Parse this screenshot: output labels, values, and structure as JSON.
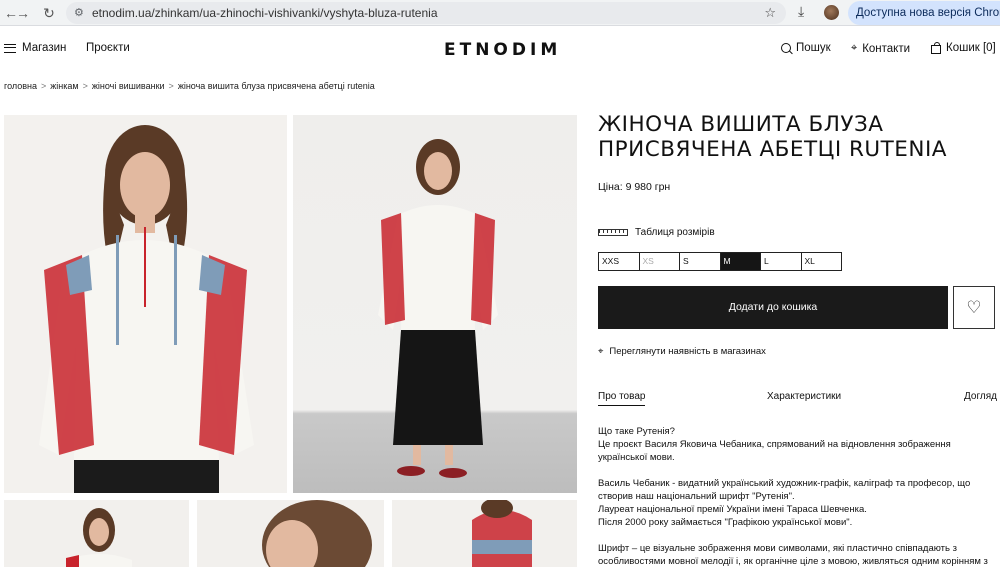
{
  "browser": {
    "url": "etnodim.ua/zhinkam/ua-zhinochi-vishivanki/vyshyta-bluza-rutenia",
    "update_label": "Доступна нова версія Chrome"
  },
  "header": {
    "menu_label": "Магазин",
    "projects_label": "Проєкти",
    "logo": "ETNODIM",
    "search_label": "Пошук",
    "contacts_label": "Контакти",
    "cart_label": "Кошик [0]"
  },
  "breadcrumb": [
    "головна",
    "жінкам",
    "жіночі вишиванки",
    "жіноча вишита блуза присвячена абетці rutenia"
  ],
  "product": {
    "title": "Жіноча вишита блуза присвячена абетці Rutenia",
    "price": "Ціна: 9 980 грн",
    "size_table_label": "Таблиця розмірів",
    "sizes": [
      {
        "label": "XXS",
        "state": "available"
      },
      {
        "label": "XS",
        "state": "disabled"
      },
      {
        "label": "S",
        "state": "available"
      },
      {
        "label": "M",
        "state": "selected"
      },
      {
        "label": "L",
        "state": "available"
      },
      {
        "label": "XL",
        "state": "available"
      }
    ],
    "add_to_cart_label": "Додати до кошика",
    "availability_label": "Переглянути наявність в магазинах"
  },
  "tabs": [
    "Про товар",
    "Характеристики",
    "Догляд"
  ],
  "description": [
    "Що таке Рутенія?\nЦе проєкт Василя Яковича Чебаника, спрямований на відновлення зображення української мови.",
    "Василь Чебаник - видатний український художник-графік, каліграф та професор, що створив наш національний шрифт \"Рутенія\".\nЛауреат національної премії України імені Тараса Шевченка.\nПісля 2000 року займається \"Графікою української мови\".",
    "Шрифт – це візуальне зображення мови символами, які пластично співпадають з особливостями мовної мелодії і, як органічне ціле з мовою, живляться одним корінням з"
  ],
  "colors": {
    "accent_dark": "#1a1a1a",
    "embroidery_red": "#c8232c",
    "embroidery_blue": "#7f9cb8",
    "chrome_pill": "#d3e3fd"
  },
  "icons": [
    "back-arrow-icon",
    "forward-arrow-icon",
    "reload-icon",
    "site-settings-icon",
    "star-icon",
    "download-icon",
    "menu-icon",
    "search-icon",
    "location-pin-icon",
    "bag-icon",
    "ruler-icon",
    "heart-icon"
  ]
}
